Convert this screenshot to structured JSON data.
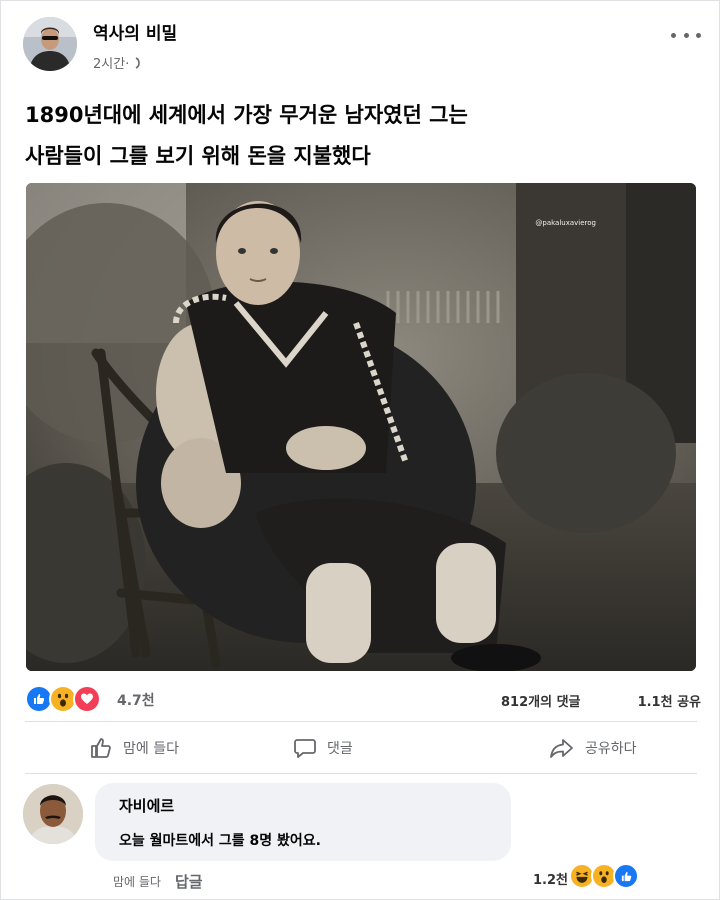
{
  "post": {
    "page_name": "역사의 비밀",
    "time": "2시간·",
    "text_lines": [
      "1890년대에 세계에서 가장 무거운 남자였던 그는",
      "사람들이 그를 보기 위해 돈을 지불했다"
    ],
    "photo_watermark": "@pakaluxavierog",
    "reaction_count": "4.7천",
    "comments_count": "812개의 댓글",
    "shares_count": "1.1천 공유",
    "reactions": [
      "like-icon",
      "wow-icon",
      "love-icon"
    ]
  },
  "actions": {
    "like": "좋아요",
    "like_label": "맘에 들다",
    "comment_label": "댓글",
    "share_label": "공유하다"
  },
  "comment": {
    "author": "자비에르",
    "text": "오늘 월마트에서 그를 8명 봤어요.",
    "like_label": "맘에 들다",
    "reply_label": "답글",
    "reaction_count": "1.2천",
    "reactions": [
      "haha-icon",
      "wow-icon",
      "like-icon"
    ]
  },
  "colors": {
    "like_blue": "#1877f2",
    "wow_yellow": "#f7b125",
    "love_red": "#f33e58",
    "secondary_text": "#65676b",
    "bubble_bg": "#f0f2f5"
  }
}
